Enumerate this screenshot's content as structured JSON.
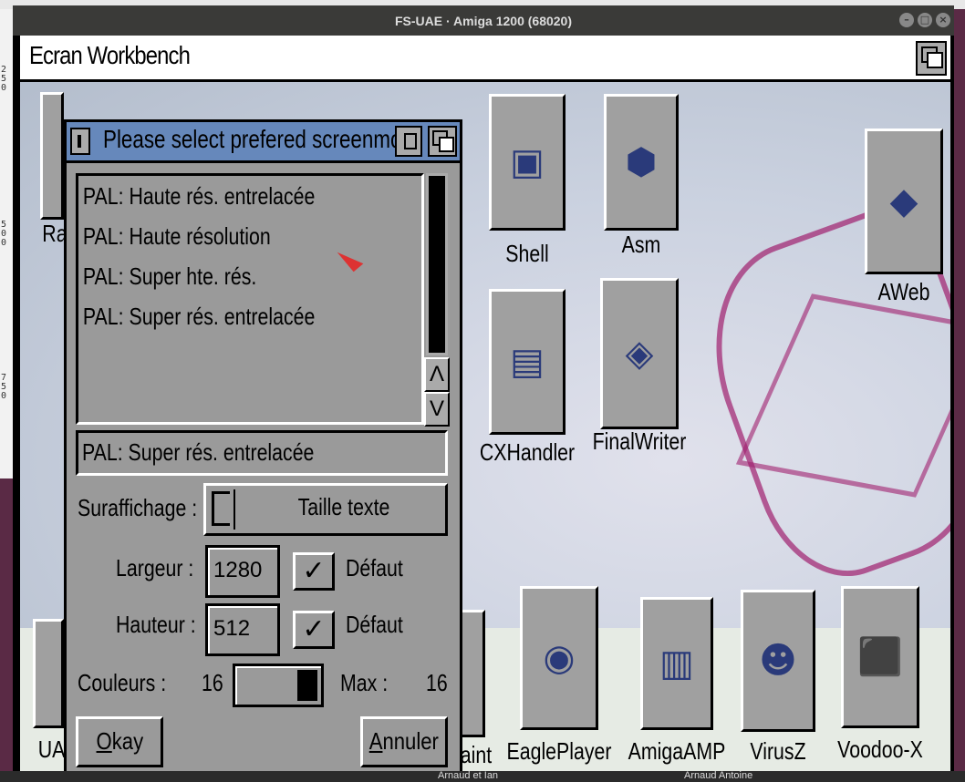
{
  "host": {
    "left_strip_numbers": [
      "2",
      "5",
      "0",
      "5",
      "0",
      "0",
      "7",
      "5",
      "0"
    ],
    "bottom_tabs": [
      "Arnaud et Ian",
      "Arnaud Antoine"
    ]
  },
  "window": {
    "title": "FS-UAE · Amiga 1200 (68020)",
    "controls": [
      "minimize-icon",
      "maximize-icon",
      "close-icon"
    ]
  },
  "screen": {
    "title": "Ecran Workbench"
  },
  "desktop_icons": [
    {
      "label": "Shell",
      "glyph": "▣"
    },
    {
      "label": "Asm",
      "glyph": "⬢"
    },
    {
      "label": "AWeb",
      "glyph": "◆"
    },
    {
      "label": "CXHandler",
      "glyph": "▤"
    },
    {
      "label": "FinalWriter",
      "glyph": "◈"
    },
    {
      "label": "EaglePlayer",
      "glyph": "◉"
    },
    {
      "label": "AmigaAMP",
      "glyph": "▥"
    },
    {
      "label": "VirusZ",
      "glyph": "☻"
    },
    {
      "label": "Voodoo-X",
      "glyph": "⬛"
    },
    {
      "label": "aint",
      "glyph": ""
    },
    {
      "label": "Ra",
      "glyph": ""
    },
    {
      "label": "UA",
      "glyph": ""
    }
  ],
  "dialog": {
    "title": "Please select prefered screenmod",
    "modes": [
      "PAL: Haute rés. entrelacée",
      "PAL: Haute résolution",
      "PAL: Super hte. rés.",
      "PAL: Super rés. entrelacée"
    ],
    "scroll_up": "Λ",
    "scroll_down": "V",
    "selected_mode": "PAL: Super rés. entrelacée",
    "overscan_label": "Suraffichage :",
    "overscan_value": "Taille texte",
    "width_label": "Largeur :",
    "width_value": "1280",
    "width_default_label": "Défaut",
    "height_label": "Hauteur :",
    "height_value": "512",
    "height_default_label": "Défaut",
    "colors_label": "Couleurs :",
    "colors_value": "16",
    "max_label": "Max :",
    "max_value": "16",
    "ok_label": "Okay",
    "cancel_label": "Annuler",
    "check_mark": "✓"
  }
}
